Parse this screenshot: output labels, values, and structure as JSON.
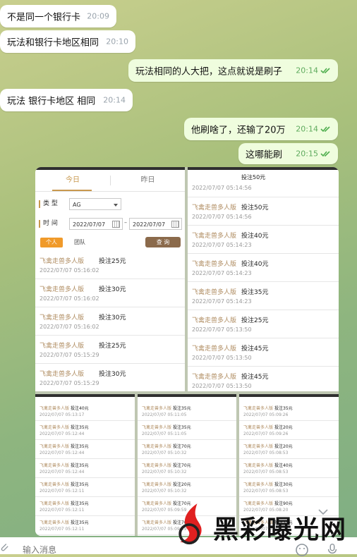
{
  "messages": [
    {
      "dir": "in",
      "text": "不是同一个银行卡",
      "time": "20:09"
    },
    {
      "dir": "in",
      "text": "玩法和银行卡地区相同",
      "time": "20:10"
    },
    {
      "dir": "out",
      "text": "玩法相同的人大把，这点就说是刷子",
      "time": "20:14",
      "status": "read"
    },
    {
      "dir": "in",
      "text": "玩法  银行卡地区 相同",
      "time": "20:14"
    },
    {
      "dir": "out",
      "text": "他刷啥了，还输了20万",
      "time": "20:14",
      "status": "read"
    },
    {
      "dir": "out",
      "text": "这哪能刷",
      "time": "20:15",
      "status": "read"
    }
  ],
  "shot_left": {
    "tabs": [
      "今日",
      "昨日"
    ],
    "active_tab": 0,
    "type_label": "类  型",
    "type_value": "AG",
    "time_label": "时  间",
    "date_from": "2022/07/07",
    "date_to": "2022/07/07",
    "btn_personal": "个人",
    "btn_team": "团队",
    "btn_query": "查 询",
    "records": [
      {
        "game": "飞禽走兽多人版",
        "amount": "投注25元",
        "datetime": "2022/07/07 05:16:02"
      },
      {
        "game": "飞禽走兽多人版",
        "amount": "投注30元",
        "datetime": "2022/07/07 05:16:02"
      },
      {
        "game": "飞禽走兽多人版",
        "amount": "投注30元",
        "datetime": "2022/07/07 05:16:02"
      },
      {
        "game": "飞禽走兽多人版",
        "amount": "投注25元",
        "datetime": "2022/07/07 05:15:29"
      },
      {
        "game": "飞禽走兽多人版",
        "amount": "投注30元",
        "datetime": "2022/07/07 05:15:29"
      }
    ]
  },
  "shot_right": {
    "first_amount": "投注50元",
    "first_datetime": "2022/07/07 05:14:56",
    "records": [
      {
        "game": "飞禽走兽多人版",
        "amount": "投注50元",
        "datetime": "2022/07/07 05:14:56"
      },
      {
        "game": "飞禽走兽多人版",
        "amount": "投注40元",
        "datetime": "2022/07/07 05:14:23"
      },
      {
        "game": "飞禽走兽多人版",
        "amount": "投注40元",
        "datetime": "2022/07/07 05:14:23"
      },
      {
        "game": "飞禽走兽多人版",
        "amount": "投注35元",
        "datetime": "2022/07/07 05:14:23"
      },
      {
        "game": "飞禽走兽多人版",
        "amount": "投注25元",
        "datetime": "2022/07/07 05:13:50"
      },
      {
        "game": "飞禽走兽多人版",
        "amount": "投注45元",
        "datetime": "2022/07/07 05:13:50"
      },
      {
        "game": "飞禽走兽多人版",
        "amount": "投注45元",
        "datetime": "2022/07/07 05:13:50"
      }
    ]
  },
  "shot_b1": {
    "records": [
      {
        "game": "飞禽走兽多人版",
        "amount": "投注40元",
        "datetime": "2022/07/07 05:13:17"
      },
      {
        "game": "飞禽走兽多人版",
        "amount": "投注35元",
        "datetime": "2022/07/07 05:12:44"
      },
      {
        "game": "飞禽走兽多人版",
        "amount": "投注35元",
        "datetime": "2022/07/07 05:12:44"
      },
      {
        "game": "飞禽走兽多人版",
        "amount": "投注35元",
        "datetime": "2022/07/07 05:12:44"
      },
      {
        "game": "飞禽走兽多人版",
        "amount": "投注35元",
        "datetime": "2022/07/07 05:12:11"
      },
      {
        "game": "飞禽走兽多人版",
        "amount": "投注35元",
        "datetime": "2022/07/07 05:12:11"
      },
      {
        "game": "飞禽走兽多人版",
        "amount": "投注35元",
        "datetime": "2022/07/07 05:12:11"
      }
    ]
  },
  "shot_b2": {
    "records": [
      {
        "game": "飞禽走兽多人版",
        "amount": "投注35元",
        "datetime": "2022/07/07 05:11:05"
      },
      {
        "game": "飞禽走兽多人版",
        "amount": "投注35元",
        "datetime": "2022/07/07 05:11:05"
      },
      {
        "game": "飞禽走兽多人版",
        "amount": "投注70元",
        "datetime": "2022/07/07 05:10:32"
      },
      {
        "game": "飞禽走兽多人版",
        "amount": "投注70元",
        "datetime": "2022/07/07 05:10:32"
      },
      {
        "game": "飞禽走兽多人版",
        "amount": "投注20元",
        "datetime": "2022/07/07 05:10:32"
      },
      {
        "game": "飞禽走兽多人版",
        "amount": "投注70元",
        "datetime": "2022/07/07 05:09:59"
      },
      {
        "game": "飞禽走兽多人版",
        "amount": "投注70元",
        "datetime": "2022/07/07 05:09:59"
      }
    ]
  },
  "shot_b3": {
    "records": [
      {
        "game": "飞禽走兽多人版",
        "amount": "投注35元",
        "datetime": "2022/07/07 05:09:26"
      },
      {
        "game": "飞禽走兽多人版",
        "amount": "投注20元",
        "datetime": "2022/07/07 05:09:26"
      },
      {
        "game": "飞禽走兽多人版",
        "amount": "投注20元",
        "datetime": "2022/07/07 05:08:53"
      },
      {
        "game": "飞禽走兽多人版",
        "amount": "投注40元",
        "datetime": "2022/07/07 05:08:53"
      },
      {
        "game": "飞禽走兽多人版",
        "amount": "投注30元",
        "datetime": "2022/07/07 05:08:53"
      },
      {
        "game": "飞禽走兽多人版",
        "amount": "投注90元",
        "datetime": "2022/07/07 05:08:20"
      },
      {
        "game": "飞禽走兽多人版",
        "amount": "投注35元",
        "datetime": "2022/07/07 05:08:20"
      }
    ]
  },
  "composer": {
    "placeholder": "输入消息"
  },
  "watermark": {
    "text": "黑彩曝光网",
    "accent": "#e02020"
  },
  "colors": {
    "incoming": "#ffffff",
    "outgoing": "#effdde",
    "read_check": "#4fae4e",
    "time_out": "#5fab5e",
    "game_name": "#b08d62",
    "accent_orange": "#f09a2a",
    "query_brown": "#8b6a4b"
  },
  "icons": [
    "double-check-icon",
    "attach-icon",
    "emoji-icon",
    "mic-icon",
    "chevron-down-icon",
    "calendar-icon",
    "dropdown-caret-icon",
    "watermark-logo-icon"
  ]
}
